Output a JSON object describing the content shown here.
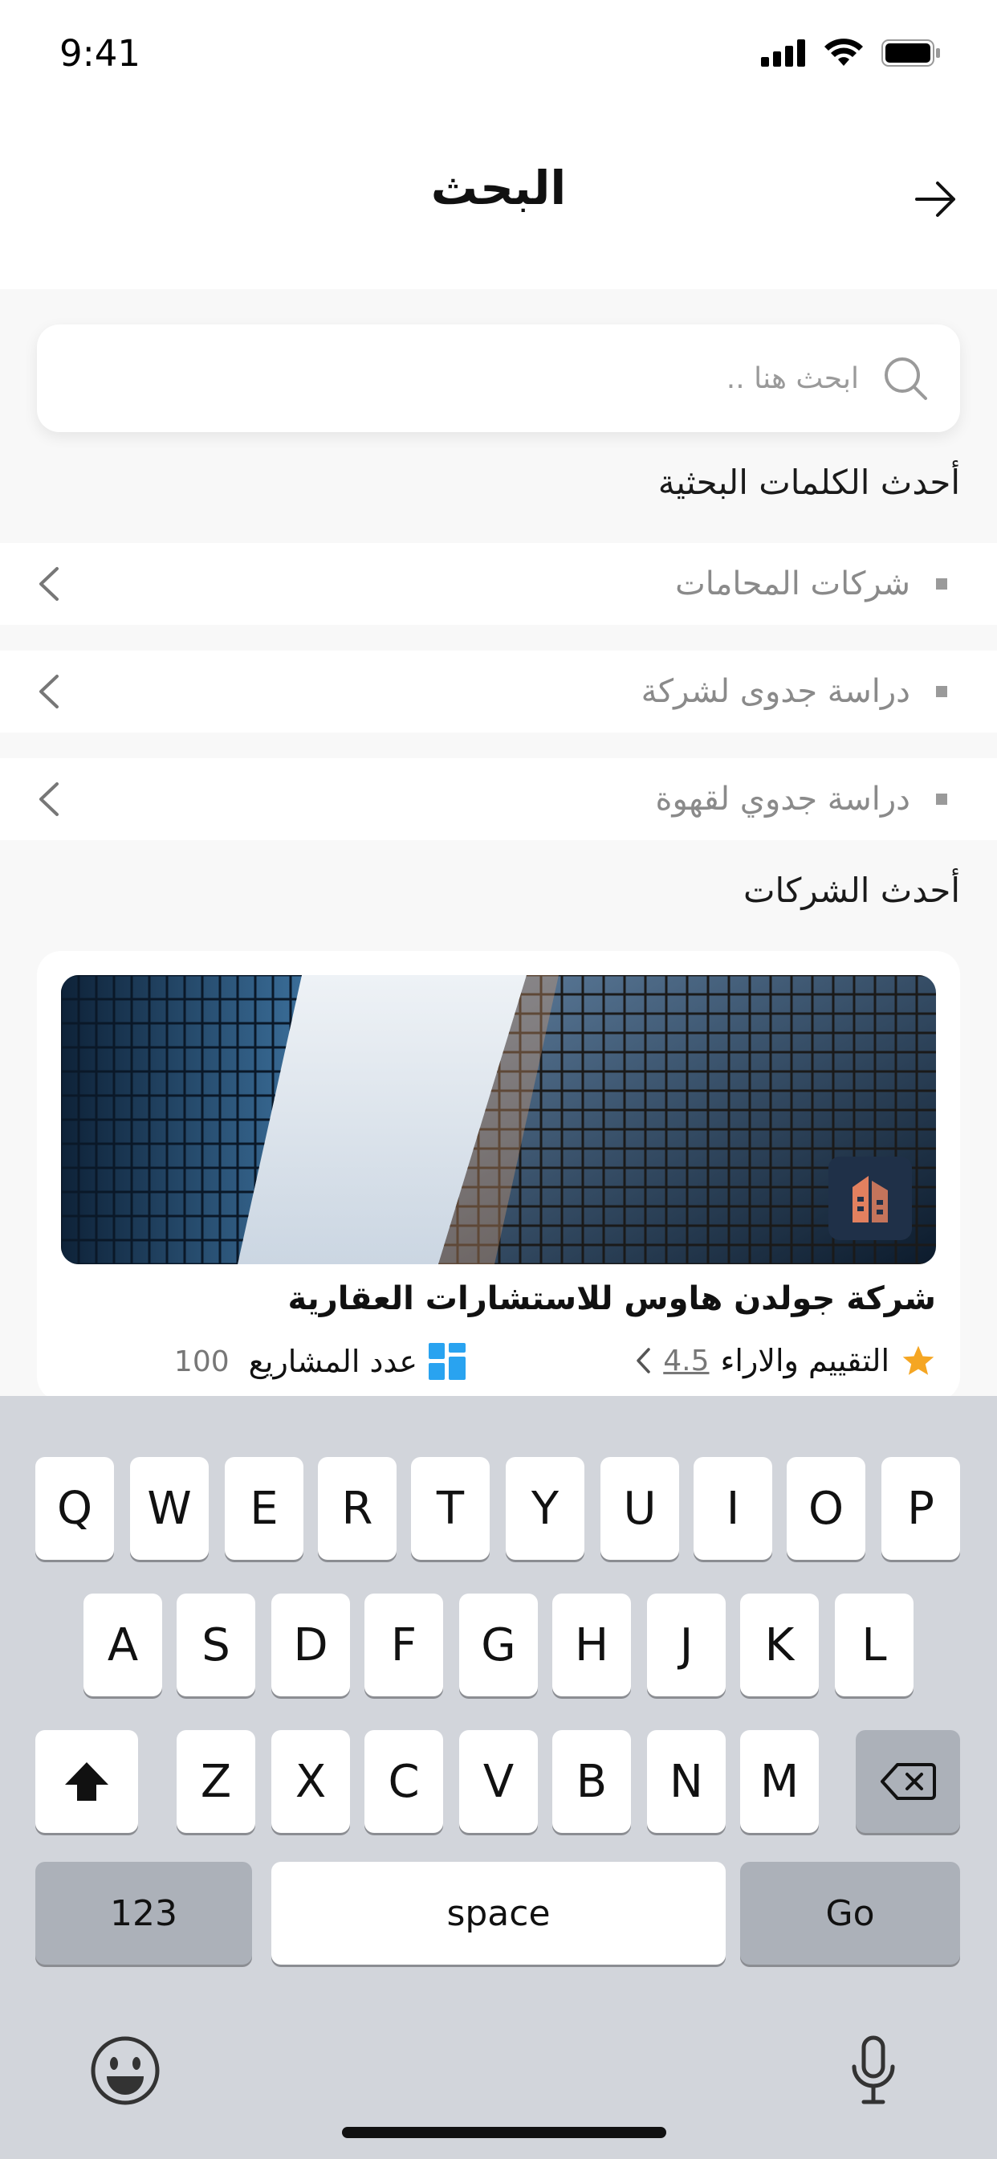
{
  "status_bar": {
    "time": "9:41"
  },
  "header": {
    "title": "البحث"
  },
  "search": {
    "placeholder": "ابحث هنا .."
  },
  "recent_searches": {
    "title": "أحدث الكلمات البحثية",
    "items": [
      {
        "label": "شركات المحامات"
      },
      {
        "label": "دراسة جدوى لشركة"
      },
      {
        "label": "دراسة جدوي لقهوة"
      }
    ]
  },
  "companies": {
    "title": "أحدث الشركات",
    "items": [
      {
        "name": "شركة جولدن هاوس للاستشارات العقارية",
        "rating_label": "التقييم والاراء",
        "rating_value": "4.5",
        "projects_label": "عدد المشاريع",
        "projects_value": "100"
      }
    ]
  },
  "keyboard": {
    "row1": [
      "Q",
      "W",
      "E",
      "R",
      "T",
      "Y",
      "U",
      "I",
      "O",
      "P"
    ],
    "row2": [
      "A",
      "S",
      "D",
      "F",
      "G",
      "H",
      "J",
      "K",
      "L"
    ],
    "row3": [
      "Z",
      "X",
      "C",
      "V",
      "B",
      "N",
      "M"
    ],
    "numbers_label": "123",
    "space_label": "space",
    "go_label": "Go"
  },
  "colors": {
    "star": "#f5a623",
    "projects_icon": "#29a3f0",
    "logo_bg": "#1f3048",
    "logo_fg": "#e2805f"
  }
}
